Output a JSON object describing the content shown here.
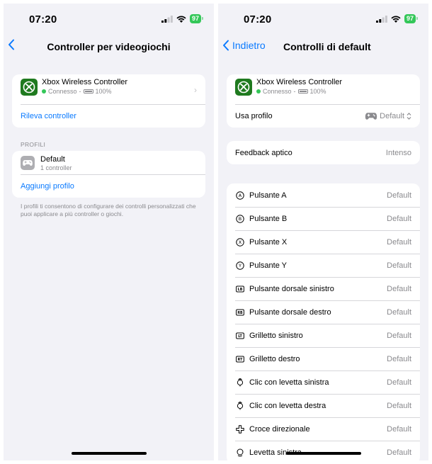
{
  "left": {
    "status": {
      "time": "07:20",
      "battery": "97"
    },
    "nav": {
      "title": "Controller per videogiochi"
    },
    "device": {
      "name": "Xbox Wireless Controller",
      "status": "Connesso",
      "separator": "-",
      "battery": "100%",
      "action": "Rileva controller"
    },
    "profiles": {
      "section_label": "PROFILI",
      "items": [
        {
          "name": "Default",
          "sub": "1 controller"
        }
      ],
      "add_label": "Aggiungi profilo",
      "footnote": "I profili ti consentono di configurare dei controlli personalizzati che puoi applicare a più controller o giochi."
    }
  },
  "right": {
    "status": {
      "time": "07:20",
      "battery": "97"
    },
    "nav": {
      "back_label": "Indietro",
      "title": "Controlli di default"
    },
    "device": {
      "name": "Xbox Wireless Controller",
      "status": "Connesso",
      "separator": "-",
      "battery": "100%"
    },
    "use_profile": {
      "label": "Usa profilo",
      "value": "Default"
    },
    "haptic": {
      "label": "Feedback aptico",
      "value": "Intenso"
    },
    "buttons": [
      {
        "glyph": "A",
        "icon": "button-a-icon",
        "label": "Pulsante A",
        "value": "Default"
      },
      {
        "glyph": "B",
        "icon": "button-b-icon",
        "label": "Pulsante B",
        "value": "Default"
      },
      {
        "glyph": "X",
        "icon": "button-x-icon",
        "label": "Pulsante X",
        "value": "Default"
      },
      {
        "glyph": "Y",
        "icon": "button-y-icon",
        "label": "Pulsante Y",
        "value": "Default"
      },
      {
        "glyph": "LB",
        "icon": "left-bumper-icon",
        "label": "Pulsante dorsale sinistro",
        "value": "Default"
      },
      {
        "glyph": "RB",
        "icon": "right-bumper-icon",
        "label": "Pulsante dorsale destro",
        "value": "Default"
      },
      {
        "glyph": "LT",
        "icon": "left-trigger-icon",
        "label": "Grilletto sinistro",
        "value": "Default"
      },
      {
        "glyph": "RT",
        "icon": "right-trigger-icon",
        "label": "Grilletto destro",
        "value": "Default"
      },
      {
        "glyph": "",
        "icon": "left-stick-click-icon",
        "label": "Clic con levetta sinistra",
        "value": "Default"
      },
      {
        "glyph": "",
        "icon": "right-stick-click-icon",
        "label": "Clic con levetta destra",
        "value": "Default"
      },
      {
        "glyph": "",
        "icon": "dpad-icon",
        "label": "Croce direzionale",
        "value": "Default"
      },
      {
        "glyph": "",
        "icon": "left-stick-icon",
        "label": "Levetta sinistra",
        "value": "Default"
      }
    ]
  },
  "colors": {
    "accent": "#0a7aff",
    "green": "#34c759",
    "xbox": "#1f7a1f",
    "background": "#f2f2f7"
  }
}
